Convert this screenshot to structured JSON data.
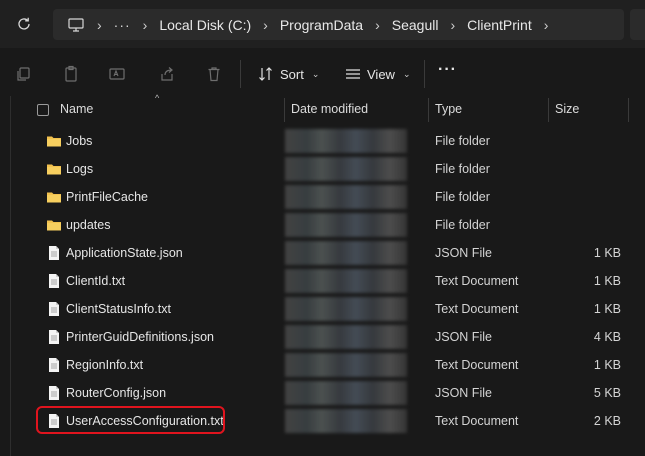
{
  "address_bar": {
    "overflow": "···",
    "crumbs": [
      "Local Disk (C:)",
      "ProgramData",
      "Seagull",
      "ClientPrint"
    ]
  },
  "commands": {
    "sort_label": "Sort",
    "view_label": "View",
    "more_label": "···"
  },
  "columns": {
    "name": "Name",
    "date_modified": "Date modified",
    "type": "Type",
    "size": "Size"
  },
  "files": [
    {
      "name": "Jobs",
      "type": "File folder",
      "size": "",
      "icon": "folder-icon"
    },
    {
      "name": "Logs",
      "type": "File folder",
      "size": "",
      "icon": "folder-icon"
    },
    {
      "name": "PrintFileCache",
      "type": "File folder",
      "size": "",
      "icon": "folder-icon"
    },
    {
      "name": "updates",
      "type": "File folder",
      "size": "",
      "icon": "folder-icon"
    },
    {
      "name": "ApplicationState.json",
      "type": "JSON File",
      "size": "1 KB",
      "icon": "file-icon"
    },
    {
      "name": "ClientId.txt",
      "type": "Text Document",
      "size": "1 KB",
      "icon": "file-icon"
    },
    {
      "name": "ClientStatusInfo.txt",
      "type": "Text Document",
      "size": "1 KB",
      "icon": "file-icon"
    },
    {
      "name": "PrinterGuidDefinitions.json",
      "type": "JSON File",
      "size": "4 KB",
      "icon": "file-icon"
    },
    {
      "name": "RegionInfo.txt",
      "type": "Text Document",
      "size": "1 KB",
      "icon": "file-icon"
    },
    {
      "name": "RouterConfig.json",
      "type": "JSON File",
      "size": "5 KB",
      "icon": "file-icon"
    },
    {
      "name": "UserAccessConfiguration.txt",
      "type": "Text Document",
      "size": "2 KB",
      "icon": "file-icon"
    }
  ],
  "colors": {
    "folder": "#f2c14e",
    "highlight": "#e0141e",
    "background": "#191919"
  }
}
